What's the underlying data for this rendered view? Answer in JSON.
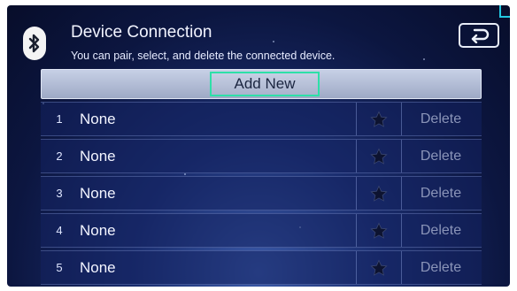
{
  "header": {
    "title": "Device Connection",
    "subtitle": "You can pair, select, and delete the connected device."
  },
  "icons": {
    "bluetooth": "bluetooth-icon",
    "back": "back-arrow-icon",
    "favorite": "star-icon"
  },
  "add_new_label": "Add New",
  "devices": [
    {
      "index": "1",
      "name": "None",
      "delete_label": "Delete"
    },
    {
      "index": "2",
      "name": "None",
      "delete_label": "Delete"
    },
    {
      "index": "3",
      "name": "None",
      "delete_label": "Delete"
    },
    {
      "index": "4",
      "name": "None",
      "delete_label": "Delete"
    },
    {
      "index": "5",
      "name": "None",
      "delete_label": "Delete"
    }
  ],
  "colors": {
    "focus_outline": "#2ee0a8",
    "accent_corner": "#22c7e0",
    "text_disabled": "#8a94b8"
  }
}
